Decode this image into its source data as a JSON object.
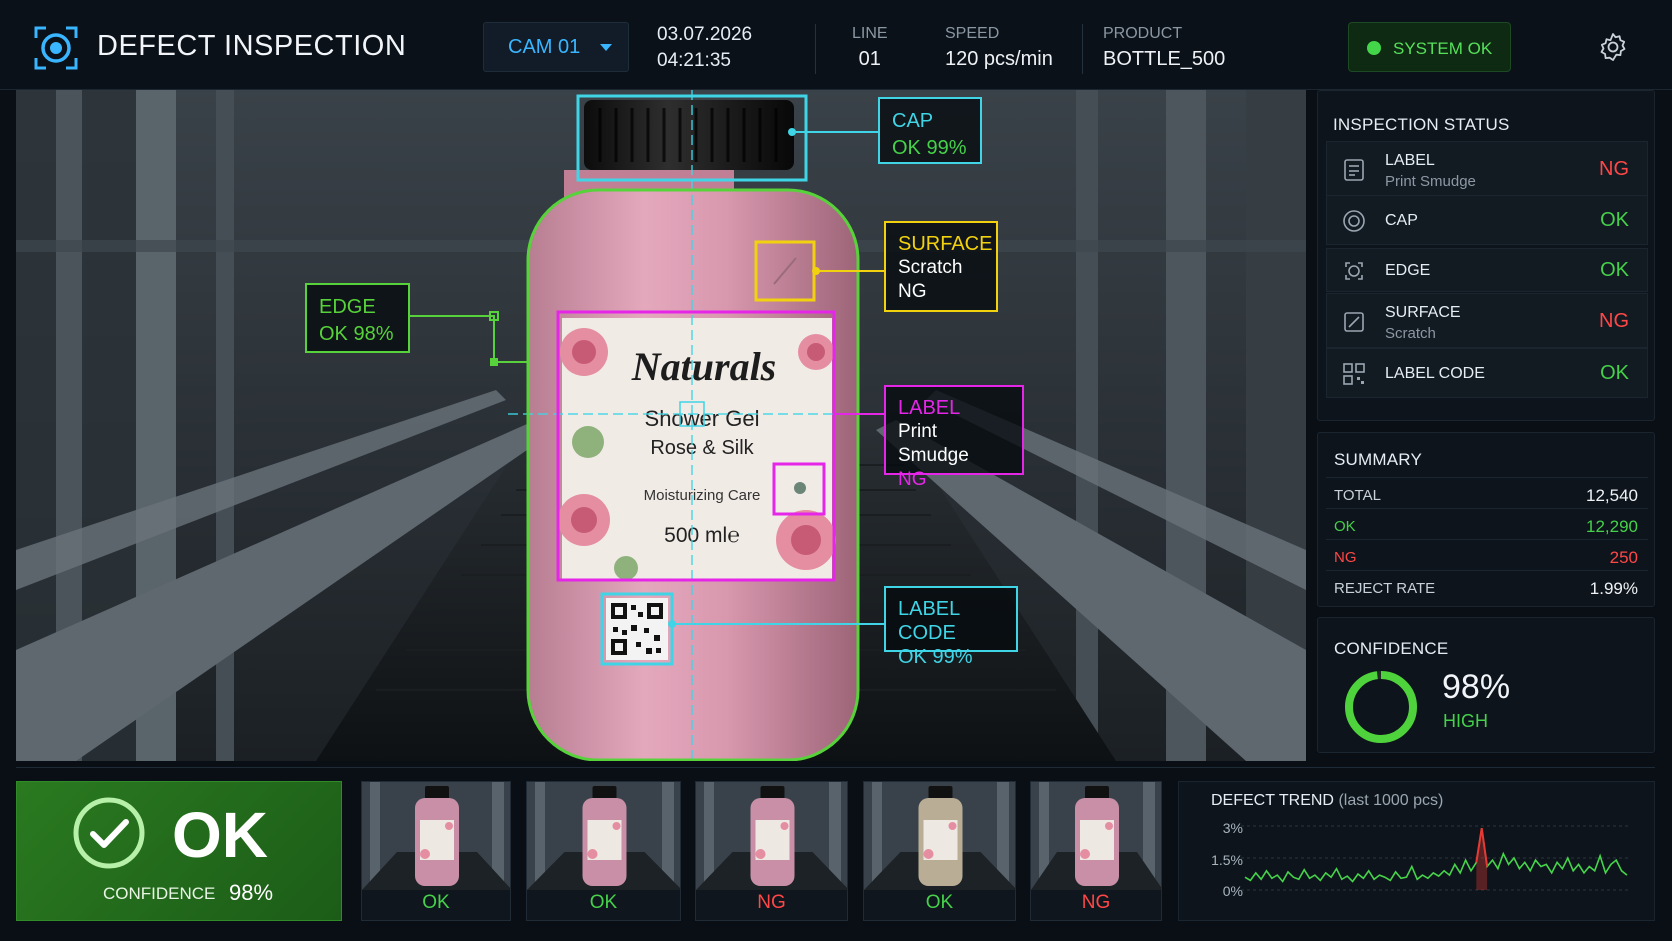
{
  "header": {
    "title": "DEFECT INSPECTION",
    "camera": "CAM 01",
    "date": "03.07.2026",
    "time": "04:21:35",
    "line_label": "LINE",
    "line_value": "01",
    "speed_label": "SPEED",
    "speed_value": "120 pcs/min",
    "product_label": "PRODUCT",
    "product_value": "BOTTLE_500",
    "system_status": "SYSTEM OK",
    "icons": [
      "camera-lens-icon",
      "chevron-down-icon",
      "gear-icon"
    ]
  },
  "bottle_label": {
    "brand": "Naturals",
    "line1": "Shower Gel",
    "line2": "Rose & Silk",
    "line3": "Moisturizing Care",
    "volume": "500 ml℮"
  },
  "annotations": {
    "cap": {
      "title": "CAP",
      "result": "OK 99%"
    },
    "surface": {
      "title": "SURFACE",
      "detail": "Scratch",
      "result": "NG"
    },
    "edge": {
      "title": "EDGE",
      "result": "OK 98%"
    },
    "label": {
      "title": "LABEL",
      "detail": "Print Smudge",
      "result": "NG"
    },
    "label_code": {
      "title": "LABEL CODE",
      "result": "OK 99%"
    }
  },
  "inspection_status": {
    "title": "INSPECTION STATUS",
    "items": [
      {
        "name": "LABEL",
        "sub": "Print Smudge",
        "status": "NG",
        "icon": "label-icon"
      },
      {
        "name": "CAP",
        "sub": "",
        "status": "OK",
        "icon": "cap-icon"
      },
      {
        "name": "EDGE",
        "sub": "",
        "status": "OK",
        "icon": "edge-icon"
      },
      {
        "name": "SURFACE",
        "sub": "Scratch",
        "status": "NG",
        "icon": "surface-icon"
      },
      {
        "name": "LABEL CODE",
        "sub": "",
        "status": "OK",
        "icon": "qr-code-icon"
      }
    ]
  },
  "summary": {
    "title": "SUMMARY",
    "total_label": "TOTAL",
    "total_value": "12,540",
    "ok_label": "OK",
    "ok_value": "12,290",
    "ng_label": "NG",
    "ng_value": "250",
    "reject_label": "REJECT RATE",
    "reject_value": "1.99%"
  },
  "confidence": {
    "title": "CONFIDENCE",
    "value": "98%",
    "level": "HIGH",
    "fraction": 0.98
  },
  "result": {
    "status": "OK",
    "confidence_label": "CONFIDENCE",
    "confidence_value": "98%",
    "icon": "check-circle-icon"
  },
  "thumbnails": [
    {
      "status": "OK",
      "tint": "#c98fa6"
    },
    {
      "status": "OK",
      "tint": "#c98fa6"
    },
    {
      "status": "NG",
      "tint": "#c98fa6"
    },
    {
      "status": "OK",
      "tint": "#b9ae95"
    },
    {
      "status": "NG",
      "tint": "#c98fa6"
    }
  ],
  "trend": {
    "title": "DEFECT TREND",
    "subtitle": "(last 1000 pcs)",
    "y_ticks": [
      "3%",
      "1.5%",
      "0%"
    ],
    "ylim": [
      0,
      3
    ],
    "values": [
      0.6,
      0.45,
      0.8,
      0.5,
      0.9,
      0.55,
      0.7,
      0.4,
      0.85,
      0.6,
      0.5,
      0.95,
      0.55,
      0.7,
      0.45,
      0.8,
      0.6,
      1.0,
      0.5,
      0.65,
      0.4,
      0.75,
      0.55,
      0.9,
      0.5,
      0.7,
      0.6,
      0.45,
      0.85,
      0.55,
      0.6,
      1.1,
      0.5,
      0.7,
      0.55,
      0.8,
      0.65,
      0.9,
      0.7,
      1.2,
      0.8,
      1.4,
      0.9,
      1.3,
      2.9,
      1.1,
      1.4,
      1.0,
      1.7,
      1.2,
      1.5,
      1.0,
      1.3,
      0.9,
      1.4,
      1.1,
      1.2,
      0.8,
      1.3,
      1.0,
      1.5,
      0.9,
      1.2,
      0.8,
      1.1,
      0.9,
      1.6,
      0.8,
      1.2,
      1.4,
      0.9,
      0.7
    ],
    "colors": {
      "line": "#46d44b",
      "spike": "#e53935"
    }
  },
  "colors": {
    "ok": "#45d14a",
    "ng": "#ff4747",
    "cyan": "#3fd5e6",
    "yellow": "#f2d20f",
    "magenta": "#e526e8",
    "green": "#57d23a"
  }
}
